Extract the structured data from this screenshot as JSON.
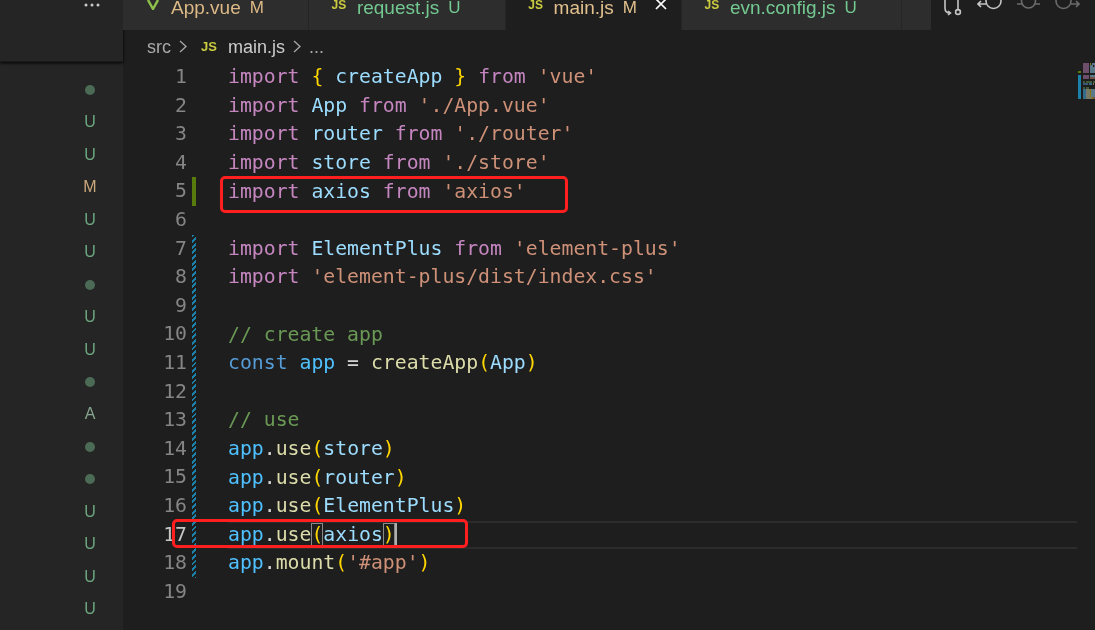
{
  "sidebar": {
    "decorations": [
      {
        "kind": "dot",
        "color": "#4b6b56"
      },
      {
        "kind": "letter",
        "text": "U",
        "color": "#6ba67e"
      },
      {
        "kind": "letter",
        "text": "U",
        "color": "#6ba67e"
      },
      {
        "kind": "letter",
        "text": "M",
        "color": "#c9a87a"
      },
      {
        "kind": "letter",
        "text": "U",
        "color": "#6ba67e"
      },
      {
        "kind": "letter",
        "text": "U",
        "color": "#6ba67e"
      },
      {
        "kind": "dot",
        "color": "#4b6b56"
      },
      {
        "kind": "letter",
        "text": "U",
        "color": "#6ba67e"
      },
      {
        "kind": "letter",
        "text": "U",
        "color": "#6ba67e"
      },
      {
        "kind": "dot",
        "color": "#4b6b56"
      },
      {
        "kind": "letter",
        "text": "A",
        "color": "#85a58e"
      },
      {
        "kind": "dot",
        "color": "#4b6b56"
      },
      {
        "kind": "dot",
        "color": "#4b6b56"
      },
      {
        "kind": "letter",
        "text": "U",
        "color": "#6ba67e"
      },
      {
        "kind": "letter",
        "text": "U",
        "color": "#6ba67e"
      },
      {
        "kind": "letter",
        "text": "U",
        "color": "#6ba67e"
      },
      {
        "kind": "letter",
        "text": "U",
        "color": "#6ba67e"
      }
    ]
  },
  "tabs": [
    {
      "label": "App.vue",
      "icon": {
        "kind": "vue"
      },
      "status": "M",
      "color": "#dcb985",
      "selected": false
    },
    {
      "label": "request.js",
      "icon": {
        "kind": "js",
        "text": "JS"
      },
      "status": "U",
      "color": "#73c991",
      "selected": false
    },
    {
      "label": "main.js",
      "icon": {
        "kind": "js",
        "text": "JS"
      },
      "status": "M",
      "color": "#e2c08d",
      "selected": true
    },
    {
      "label": "evn.config.js",
      "icon": {
        "kind": "js",
        "text": "JS"
      },
      "status": "U",
      "color": "#73c991",
      "selected": false
    }
  ],
  "breadcrumb": {
    "items": [
      {
        "kind": "folder",
        "label": "src"
      },
      {
        "kind": "file",
        "label": "main.js",
        "icon": {
          "kind": "js",
          "text": "JS"
        }
      },
      {
        "kind": "more",
        "label": "..."
      }
    ]
  },
  "editor": {
    "lines": [
      {
        "number": "1",
        "kind": "unchanged",
        "current": false,
        "tokens": [
          {
            "text": "import ",
            "kind": "keyword"
          },
          {
            "text": "{",
            "kind": "bracket"
          },
          {
            "text": " createApp ",
            "kind": "variable"
          },
          {
            "text": "}",
            "kind": "bracket"
          },
          {
            "text": " from ",
            "kind": "keyword"
          },
          {
            "text": "'vue'",
            "kind": "string"
          }
        ]
      },
      {
        "number": "2",
        "kind": "unchanged",
        "current": false,
        "tokens": [
          {
            "text": "import ",
            "kind": "keyword"
          },
          {
            "text": "App ",
            "kind": "variable"
          },
          {
            "text": "from ",
            "kind": "keyword"
          },
          {
            "text": "'./App.vue'",
            "kind": "string"
          }
        ]
      },
      {
        "number": "3",
        "kind": "unchanged",
        "current": false,
        "tokens": [
          {
            "text": "import ",
            "kind": "keyword"
          },
          {
            "text": "router ",
            "kind": "variable"
          },
          {
            "text": "from ",
            "kind": "keyword"
          },
          {
            "text": "'./router'",
            "kind": "string"
          }
        ]
      },
      {
        "number": "4",
        "kind": "unchanged",
        "current": false,
        "tokens": [
          {
            "text": "import ",
            "kind": "keyword"
          },
          {
            "text": "store ",
            "kind": "variable"
          },
          {
            "text": "from ",
            "kind": "keyword"
          },
          {
            "text": "'./store'",
            "kind": "string"
          }
        ]
      },
      {
        "number": "5",
        "kind": "added",
        "current": false,
        "annotation": {
          "kind": "code"
        },
        "tokens": [
          {
            "text": "import ",
            "kind": "keyword"
          },
          {
            "text": "axios ",
            "kind": "variable"
          },
          {
            "text": "from ",
            "kind": "keyword"
          },
          {
            "text": "'axios'",
            "kind": "string"
          }
        ]
      },
      {
        "number": "6",
        "kind": "unchanged",
        "current": false
      },
      {
        "number": "7",
        "kind": "modified",
        "current": false,
        "tokens": [
          {
            "text": "import ",
            "kind": "keyword"
          },
          {
            "text": "ElementPlus ",
            "kind": "variable"
          },
          {
            "text": "from ",
            "kind": "keyword"
          },
          {
            "text": "'element-plus'",
            "kind": "string"
          }
        ]
      },
      {
        "number": "8",
        "kind": "modified",
        "current": false,
        "tokens": [
          {
            "text": "import ",
            "kind": "keyword"
          },
          {
            "text": "'element-plus/dist/index.css'",
            "kind": "string"
          }
        ]
      },
      {
        "number": "9",
        "kind": "modified",
        "current": false
      },
      {
        "number": "10",
        "kind": "modified",
        "current": false,
        "tokens": [
          {
            "text": "// create app",
            "kind": "comment"
          }
        ]
      },
      {
        "number": "11",
        "kind": "modified",
        "current": false,
        "tokens": [
          {
            "text": "const ",
            "kind": "storage"
          },
          {
            "text": "app",
            "kind": "constant"
          },
          {
            "text": " = ",
            "kind": "plain"
          },
          {
            "text": "createApp",
            "kind": "function"
          },
          {
            "text": "(",
            "kind": "bracket"
          },
          {
            "text": "App",
            "kind": "variable"
          },
          {
            "text": ")",
            "kind": "bracket"
          }
        ]
      },
      {
        "number": "12",
        "kind": "modified",
        "current": false
      },
      {
        "number": "13",
        "kind": "modified",
        "current": false,
        "tokens": [
          {
            "text": "// use",
            "kind": "comment"
          }
        ]
      },
      {
        "number": "14",
        "kind": "modified",
        "current": false,
        "tokens": [
          {
            "text": "app",
            "kind": "constant"
          },
          {
            "text": ".",
            "kind": "plain"
          },
          {
            "text": "use",
            "kind": "function"
          },
          {
            "text": "(",
            "kind": "bracket"
          },
          {
            "text": "store",
            "kind": "variable"
          },
          {
            "text": ")",
            "kind": "bracket"
          }
        ]
      },
      {
        "number": "15",
        "kind": "modified",
        "current": false,
        "tokens": [
          {
            "text": "app",
            "kind": "constant"
          },
          {
            "text": ".",
            "kind": "plain"
          },
          {
            "text": "use",
            "kind": "function"
          },
          {
            "text": "(",
            "kind": "bracket"
          },
          {
            "text": "router",
            "kind": "variable"
          },
          {
            "text": ")",
            "kind": "bracket"
          }
        ]
      },
      {
        "number": "16",
        "kind": "modified",
        "current": false,
        "tokens": [
          {
            "text": "app",
            "kind": "constant"
          },
          {
            "text": ".",
            "kind": "plain"
          },
          {
            "text": "use",
            "kind": "function"
          },
          {
            "text": "(",
            "kind": "bracket"
          },
          {
            "text": "ElementPlus",
            "kind": "variable"
          },
          {
            "text": ")",
            "kind": "bracket"
          }
        ]
      },
      {
        "number": "17",
        "kind": "modified",
        "current": true,
        "annotation": {
          "kind": "number"
        },
        "tokens": [
          {
            "text": "app",
            "kind": "constant"
          },
          {
            "text": ".",
            "kind": "plain"
          },
          {
            "text": "use",
            "kind": "function"
          },
          {
            "text": "(",
            "kind": "bracket_match"
          },
          {
            "text": "axios",
            "kind": "variable"
          },
          {
            "text": ")",
            "kind": "bracket_match"
          }
        ]
      },
      {
        "number": "18",
        "kind": "modified",
        "current": false,
        "tokens": [
          {
            "text": "app",
            "kind": "constant"
          },
          {
            "text": ".",
            "kind": "plain"
          },
          {
            "text": "mount",
            "kind": "function"
          },
          {
            "text": "(",
            "kind": "bracket"
          },
          {
            "text": "'#app'",
            "kind": "string"
          },
          {
            "text": ")",
            "kind": "bracket"
          }
        ]
      },
      {
        "number": "19",
        "kind": "unchanged",
        "current": false
      }
    ]
  }
}
